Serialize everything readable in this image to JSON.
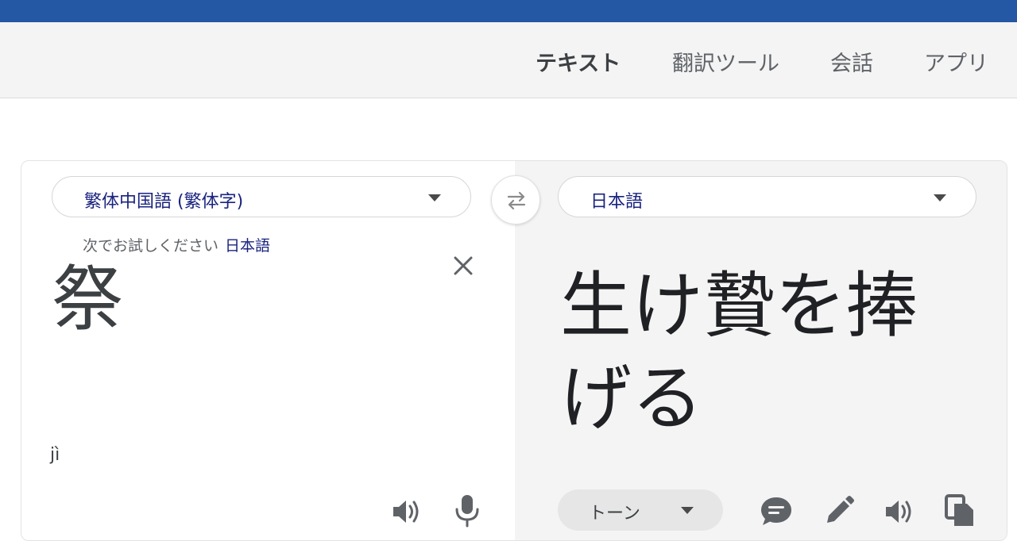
{
  "tabs": [
    {
      "label": "テキスト",
      "active": true
    },
    {
      "label": "翻訳ツール",
      "active": false
    },
    {
      "label": "会話",
      "active": false
    },
    {
      "label": "アプリ",
      "active": false
    }
  ],
  "source": {
    "language": "繁体中国語 (繁体字)",
    "suggest_prefix": "次でお試しください",
    "suggest_language": "日本語",
    "text": "祭",
    "romanization": "jì"
  },
  "target": {
    "language": "日本語",
    "text": "生け贄を捧げる",
    "tone_label": "トーン"
  },
  "icons": {
    "swap": "swap-arrows-icon",
    "clear": "close-icon",
    "source_speaker": "speaker-icon",
    "mic": "microphone-icon",
    "feedback": "feedback-icon",
    "edit": "pencil-icon",
    "target_speaker": "speaker-icon",
    "copy": "copy-icon"
  },
  "colors": {
    "top_bar": "#2457a4",
    "link": "#1a237e",
    "icon": "#5f6368"
  }
}
